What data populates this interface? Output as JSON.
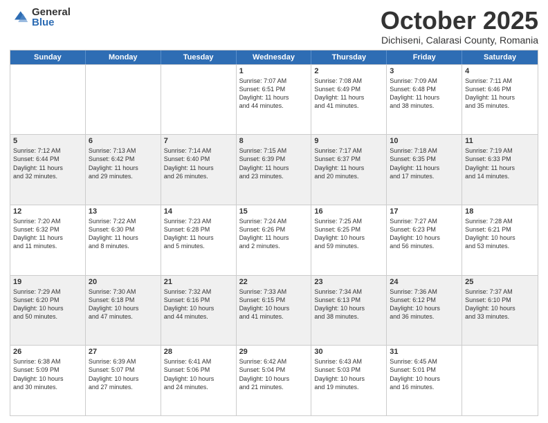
{
  "header": {
    "logo": {
      "general": "General",
      "blue": "Blue"
    },
    "title": "October 2025",
    "subtitle": "Dichiseni, Calarasi County, Romania"
  },
  "calendar": {
    "days": [
      "Sunday",
      "Monday",
      "Tuesday",
      "Wednesday",
      "Thursday",
      "Friday",
      "Saturday"
    ],
    "rows": [
      [
        {
          "day": "",
          "info": ""
        },
        {
          "day": "",
          "info": ""
        },
        {
          "day": "",
          "info": ""
        },
        {
          "day": "1",
          "info": "Sunrise: 7:07 AM\nSunset: 6:51 PM\nDaylight: 11 hours\nand 44 minutes."
        },
        {
          "day": "2",
          "info": "Sunrise: 7:08 AM\nSunset: 6:49 PM\nDaylight: 11 hours\nand 41 minutes."
        },
        {
          "day": "3",
          "info": "Sunrise: 7:09 AM\nSunset: 6:48 PM\nDaylight: 11 hours\nand 38 minutes."
        },
        {
          "day": "4",
          "info": "Sunrise: 7:11 AM\nSunset: 6:46 PM\nDaylight: 11 hours\nand 35 minutes."
        }
      ],
      [
        {
          "day": "5",
          "info": "Sunrise: 7:12 AM\nSunset: 6:44 PM\nDaylight: 11 hours\nand 32 minutes."
        },
        {
          "day": "6",
          "info": "Sunrise: 7:13 AM\nSunset: 6:42 PM\nDaylight: 11 hours\nand 29 minutes."
        },
        {
          "day": "7",
          "info": "Sunrise: 7:14 AM\nSunset: 6:40 PM\nDaylight: 11 hours\nand 26 minutes."
        },
        {
          "day": "8",
          "info": "Sunrise: 7:15 AM\nSunset: 6:39 PM\nDaylight: 11 hours\nand 23 minutes."
        },
        {
          "day": "9",
          "info": "Sunrise: 7:17 AM\nSunset: 6:37 PM\nDaylight: 11 hours\nand 20 minutes."
        },
        {
          "day": "10",
          "info": "Sunrise: 7:18 AM\nSunset: 6:35 PM\nDaylight: 11 hours\nand 17 minutes."
        },
        {
          "day": "11",
          "info": "Sunrise: 7:19 AM\nSunset: 6:33 PM\nDaylight: 11 hours\nand 14 minutes."
        }
      ],
      [
        {
          "day": "12",
          "info": "Sunrise: 7:20 AM\nSunset: 6:32 PM\nDaylight: 11 hours\nand 11 minutes."
        },
        {
          "day": "13",
          "info": "Sunrise: 7:22 AM\nSunset: 6:30 PM\nDaylight: 11 hours\nand 8 minutes."
        },
        {
          "day": "14",
          "info": "Sunrise: 7:23 AM\nSunset: 6:28 PM\nDaylight: 11 hours\nand 5 minutes."
        },
        {
          "day": "15",
          "info": "Sunrise: 7:24 AM\nSunset: 6:26 PM\nDaylight: 11 hours\nand 2 minutes."
        },
        {
          "day": "16",
          "info": "Sunrise: 7:25 AM\nSunset: 6:25 PM\nDaylight: 10 hours\nand 59 minutes."
        },
        {
          "day": "17",
          "info": "Sunrise: 7:27 AM\nSunset: 6:23 PM\nDaylight: 10 hours\nand 56 minutes."
        },
        {
          "day": "18",
          "info": "Sunrise: 7:28 AM\nSunset: 6:21 PM\nDaylight: 10 hours\nand 53 minutes."
        }
      ],
      [
        {
          "day": "19",
          "info": "Sunrise: 7:29 AM\nSunset: 6:20 PM\nDaylight: 10 hours\nand 50 minutes."
        },
        {
          "day": "20",
          "info": "Sunrise: 7:30 AM\nSunset: 6:18 PM\nDaylight: 10 hours\nand 47 minutes."
        },
        {
          "day": "21",
          "info": "Sunrise: 7:32 AM\nSunset: 6:16 PM\nDaylight: 10 hours\nand 44 minutes."
        },
        {
          "day": "22",
          "info": "Sunrise: 7:33 AM\nSunset: 6:15 PM\nDaylight: 10 hours\nand 41 minutes."
        },
        {
          "day": "23",
          "info": "Sunrise: 7:34 AM\nSunset: 6:13 PM\nDaylight: 10 hours\nand 38 minutes."
        },
        {
          "day": "24",
          "info": "Sunrise: 7:36 AM\nSunset: 6:12 PM\nDaylight: 10 hours\nand 36 minutes."
        },
        {
          "day": "25",
          "info": "Sunrise: 7:37 AM\nSunset: 6:10 PM\nDaylight: 10 hours\nand 33 minutes."
        }
      ],
      [
        {
          "day": "26",
          "info": "Sunrise: 6:38 AM\nSunset: 5:09 PM\nDaylight: 10 hours\nand 30 minutes."
        },
        {
          "day": "27",
          "info": "Sunrise: 6:39 AM\nSunset: 5:07 PM\nDaylight: 10 hours\nand 27 minutes."
        },
        {
          "day": "28",
          "info": "Sunrise: 6:41 AM\nSunset: 5:06 PM\nDaylight: 10 hours\nand 24 minutes."
        },
        {
          "day": "29",
          "info": "Sunrise: 6:42 AM\nSunset: 5:04 PM\nDaylight: 10 hours\nand 21 minutes."
        },
        {
          "day": "30",
          "info": "Sunrise: 6:43 AM\nSunset: 5:03 PM\nDaylight: 10 hours\nand 19 minutes."
        },
        {
          "day": "31",
          "info": "Sunrise: 6:45 AM\nSunset: 5:01 PM\nDaylight: 10 hours\nand 16 minutes."
        },
        {
          "day": "",
          "info": ""
        }
      ]
    ]
  }
}
